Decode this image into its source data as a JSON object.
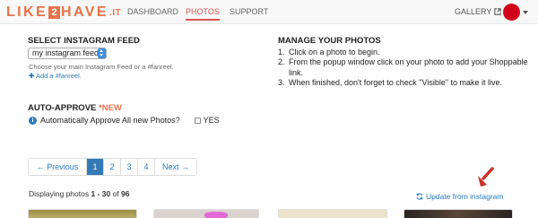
{
  "nav": {
    "logo_left": "LIKE",
    "logo_num": "2",
    "logo_right": "HAVE",
    "logo_suffix": ".IT",
    "items": [
      {
        "label": "DASHBOARD"
      },
      {
        "label": "PHOTOS"
      },
      {
        "label": "SUPPORT"
      }
    ],
    "gallery_label": "GALLERY",
    "active_item": "PHOTOS"
  },
  "feed": {
    "heading": "SELECT INSTAGRAM FEED",
    "selected": "my instagram feed",
    "help": "Choose your main Instagram Feed or a #fanreel.",
    "add_label": "Add a #fanreel."
  },
  "manage": {
    "heading": "MANAGE YOUR PHOTOS",
    "steps": [
      {
        "num": "1.",
        "text": "Click on a photo to begin."
      },
      {
        "num": "2.",
        "text": "From the popup window click on your photo to add your Shoppable link."
      },
      {
        "num": "3.",
        "text": "When finished, don't forget to check \"Visible\" to make it live."
      }
    ]
  },
  "auto_approve": {
    "heading": "AUTO-APPROVE",
    "badge": "*NEW",
    "label": "Automatically Approve All new Photos?",
    "checkbox_label": "YES"
  },
  "pagination": {
    "prev": "← Previous",
    "pages": [
      "1",
      "2",
      "3",
      "4"
    ],
    "next": "Next →",
    "active_page": "1"
  },
  "status": {
    "prefix": "Displaying photos ",
    "range": "1 - 30",
    "middle": " of ",
    "total": "96",
    "update_label": "Update from instagram"
  },
  "colors": {
    "brand": "#e8734a",
    "active_nav": "#d9534f",
    "link": "#2a7ac0",
    "avatar": "#d0021b",
    "arrow": "#c9302c"
  }
}
